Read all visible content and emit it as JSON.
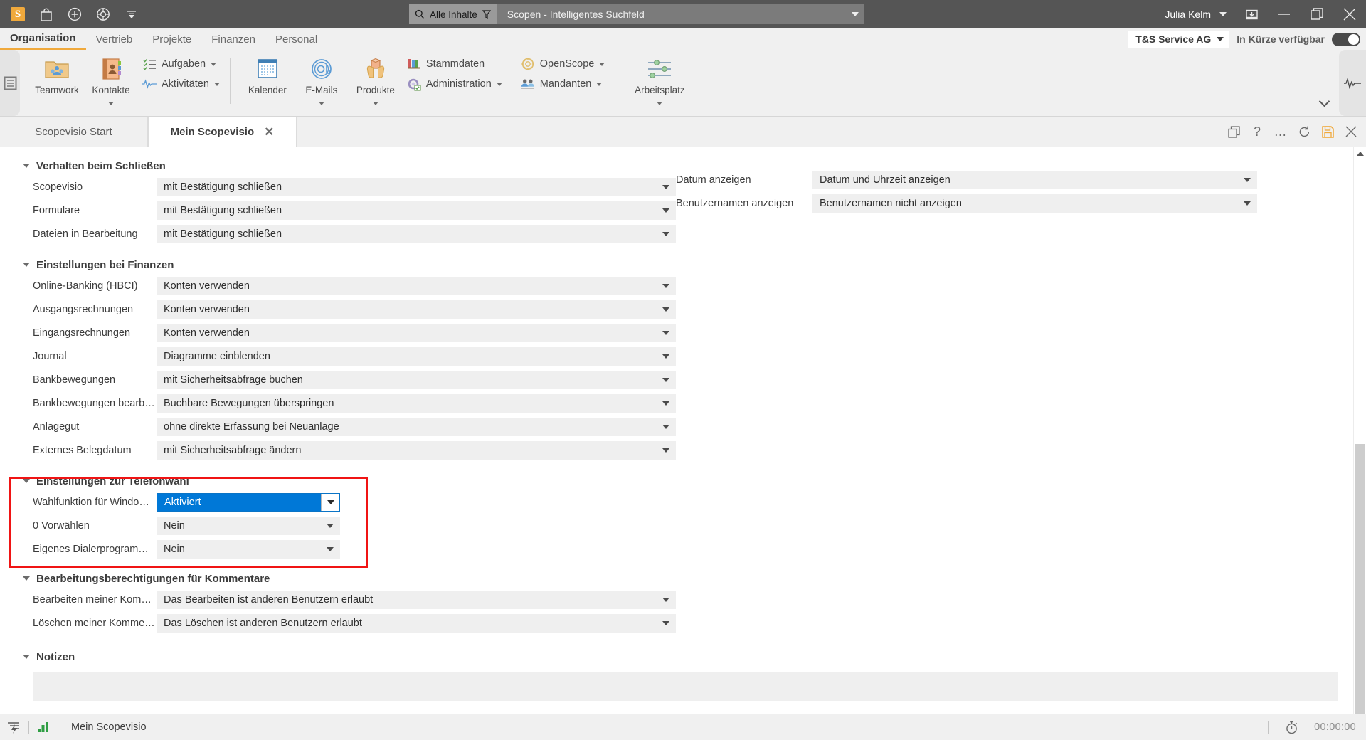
{
  "titlebar": {
    "icons": [
      "scopevisio-logo",
      "shop-icon",
      "plus-circle-icon",
      "lifebuoy-icon",
      "chevron-down-icon"
    ],
    "logo_letter": "S",
    "search": {
      "scope_label": "Alle Inhalte",
      "placeholder": "Scopen - Intelligentes Suchfeld",
      "value": "Scopen - Intelligentes Suchfeld"
    },
    "user": "Julia Kelm",
    "window_buttons": [
      "restore-down-icon",
      "minimize-icon",
      "maximize-icon",
      "close-icon"
    ]
  },
  "menubar": {
    "items": [
      {
        "label": "Organisation",
        "active": true
      },
      {
        "label": "Vertrieb",
        "active": false
      },
      {
        "label": "Projekte",
        "active": false
      },
      {
        "label": "Finanzen",
        "active": false
      },
      {
        "label": "Personal",
        "active": false
      }
    ],
    "company": "T&S Service AG",
    "soon_label": "In Kürze verfügbar",
    "toggle_on": true
  },
  "ribbon": {
    "big_buttons": [
      {
        "label": "Teamwork",
        "icon": "teamwork-folder-icon",
        "has_dropdown": false
      },
      {
        "label": "Kontakte",
        "icon": "contacts-book-icon",
        "has_dropdown": true
      },
      {
        "label": "Kalender",
        "icon": "calendar-icon",
        "has_dropdown": false
      },
      {
        "label": "E-Mails",
        "icon": "at-sign-icon",
        "has_dropdown": true
      },
      {
        "label": "Produkte",
        "icon": "product-box-hands-icon",
        "has_dropdown": true
      },
      {
        "label": "Arbeitsplatz",
        "icon": "sliders-icon",
        "has_dropdown": true
      }
    ],
    "small_group_1": [
      {
        "label": "Aufgaben",
        "icon": "task-list-icon",
        "has_dropdown": true
      },
      {
        "label": "Aktivitäten",
        "icon": "activity-pulse-icon",
        "has_dropdown": true
      }
    ],
    "small_group_2": [
      {
        "label": "Stammdaten",
        "icon": "books-shelf-icon",
        "has_dropdown": false
      },
      {
        "label": "Administration",
        "icon": "gear-icon",
        "has_dropdown": true
      }
    ],
    "small_group_3": [
      {
        "label": "OpenScope",
        "icon": "openscope-icon",
        "has_dropdown": true
      },
      {
        "label": "Mandanten",
        "icon": "clients-group-icon",
        "has_dropdown": true
      }
    ]
  },
  "tabstrip": {
    "tabs": [
      {
        "label": "Scopevisio Start",
        "active": false,
        "closable": false
      },
      {
        "label": "Mein Scopevisio",
        "active": true,
        "closable": true
      }
    ],
    "close_glyph": "✕",
    "actions": [
      "duplicate-icon",
      "help-icon",
      "more-icon",
      "refresh-icon",
      "save-icon",
      "close-icon"
    ]
  },
  "main": {
    "left_sections": [
      {
        "title": "Verhalten beim Schließen",
        "highlighted": false,
        "rows": [
          {
            "label": "Scopevisio",
            "value": "mit Bestätigung schließen",
            "selected": false
          },
          {
            "label": "Formulare",
            "value": "mit Bestätigung schließen",
            "selected": false
          },
          {
            "label": "Dateien in Bearbeitung",
            "value": "mit Bestätigung schließen",
            "selected": false
          }
        ]
      },
      {
        "title": "Einstellungen bei Finanzen",
        "highlighted": false,
        "rows": [
          {
            "label": "Online-Banking (HBCI)",
            "value": "Konten verwenden",
            "selected": false
          },
          {
            "label": "Ausgangsrechnungen",
            "value": "Konten verwenden",
            "selected": false
          },
          {
            "label": "Eingangsrechnungen",
            "value": "Konten verwenden",
            "selected": false
          },
          {
            "label": "Journal",
            "value": "Diagramme einblenden",
            "selected": false
          },
          {
            "label": "Bankbewegungen",
            "value": "mit Sicherheitsabfrage buchen",
            "selected": false
          },
          {
            "label": "Bankbewegungen bearbeiten",
            "value": "Buchbare Bewegungen überspringen",
            "selected": false
          },
          {
            "label": "Anlagegut",
            "value": "ohne direkte Erfassung bei Neuanlage",
            "selected": false
          },
          {
            "label": "Externes Belegdatum",
            "value": "mit Sicherheitsabfrage ändern",
            "selected": false
          }
        ]
      },
      {
        "title": "Einstellungen zur Telefonwahl",
        "highlighted": true,
        "rows": [
          {
            "label": "Wahlfunktion für Windows-TAPI",
            "value": "Aktiviert",
            "selected": true
          },
          {
            "label": "0 Vorwählen",
            "value": "Nein",
            "selected": false
          },
          {
            "label": "Eigenes Dialerprogramm verwen...",
            "value": "Nein",
            "selected": false
          }
        ]
      },
      {
        "title": "Bearbeitungsberechtigungen für Kommentare",
        "highlighted": false,
        "rows": [
          {
            "label": "Bearbeiten meiner Kommentare",
            "value": "Das Bearbeiten ist anderen Benutzern erlaubt",
            "selected": false
          },
          {
            "label": "Löschen meiner Kommentare",
            "value": "Das Löschen ist anderen Benutzern erlaubt",
            "selected": false
          }
        ]
      },
      {
        "title": "Notizen",
        "highlighted": false,
        "rows": [],
        "notes_value": ""
      }
    ],
    "right_rows": [
      {
        "label": "Datum anzeigen",
        "value": "Datum und Uhrzeit anzeigen"
      },
      {
        "label": "Benutzernamen anzeigen",
        "value": "Benutzernamen nicht anzeigen"
      }
    ]
  },
  "statusbar": {
    "left_icon": "filter-flash-icon",
    "chart_icon": "bar-chart-icon",
    "title": "Mein Scopevisio",
    "timer_icon": "stopwatch-icon",
    "timer": "00:00:00"
  },
  "colors": {
    "accent": "#f0a93c",
    "selection": "#0078d7",
    "highlight_box": "#f01414",
    "titlebar_bg": "#555555",
    "panel_bg": "#f0f0f0",
    "field_bg": "#efefef"
  }
}
